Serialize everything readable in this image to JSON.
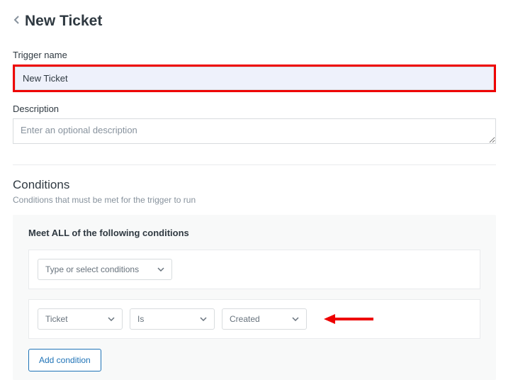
{
  "header": {
    "title": "New Ticket"
  },
  "fields": {
    "trigger_name": {
      "label": "Trigger name",
      "value": "New Ticket"
    },
    "description": {
      "label": "Description",
      "placeholder": "Enter an optional description"
    }
  },
  "conditions": {
    "title": "Conditions",
    "subtitle": "Conditions that must be met for the trigger to run",
    "all_heading": "Meet ALL of the following conditions",
    "selector_placeholder": "Type or select conditions",
    "row": {
      "field": "Ticket",
      "operator": "Is",
      "value": "Created"
    },
    "add_button": "Add condition"
  }
}
